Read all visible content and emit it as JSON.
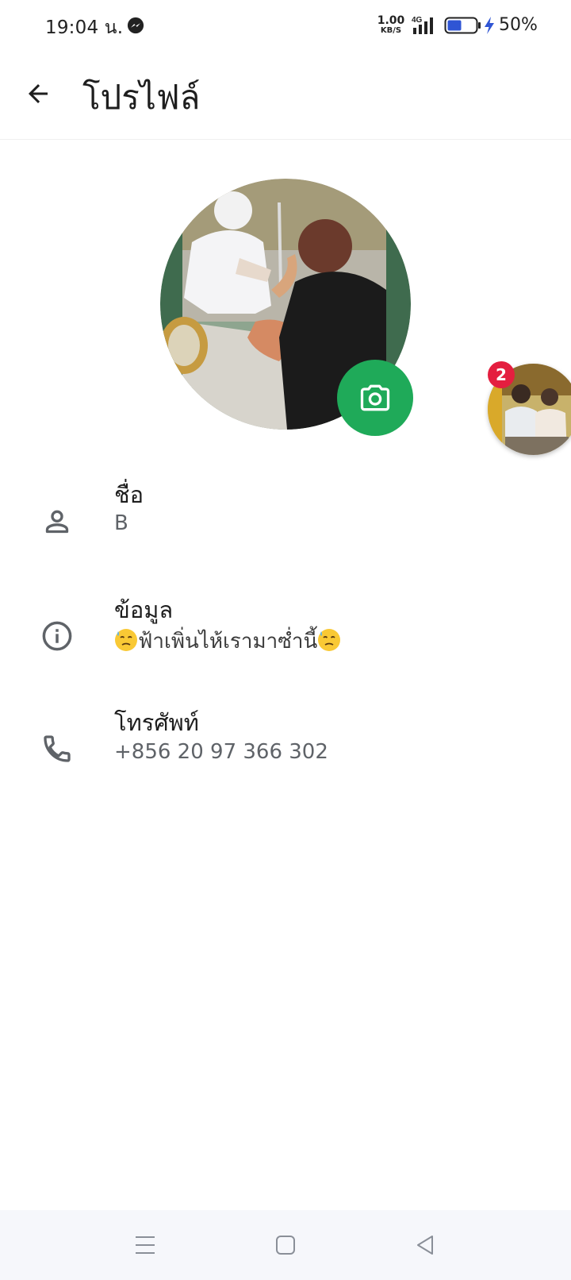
{
  "status_bar": {
    "time": "19:04 น.",
    "net_speed_value": "1.00",
    "net_speed_unit": "KB/S",
    "network_type": "4G",
    "battery_percent": "50%",
    "battery_level": 0.5
  },
  "header": {
    "title": "โปรไฟล์"
  },
  "chat_head": {
    "badge_count": "2"
  },
  "profile": {
    "name_label": "ชื่อ",
    "name_value": "B",
    "about_label": "ข้อมูล",
    "about_text": "ฟ้าเพิ่นไห้เรามาซ่ำนี้",
    "phone_label": "โทรศัพท์",
    "phone_value": "+856 20 97 366 302"
  },
  "colors": {
    "accent_green": "#1faa59",
    "badge_red": "#e41e3f",
    "icon_gray": "#5f6368"
  },
  "icons": [
    "messenger-icon",
    "signal-icon",
    "battery-icon",
    "charging-icon",
    "back-arrow-icon",
    "camera-icon",
    "person-icon",
    "info-icon",
    "phone-icon",
    "menu-icon",
    "home-icon",
    "back-icon"
  ]
}
